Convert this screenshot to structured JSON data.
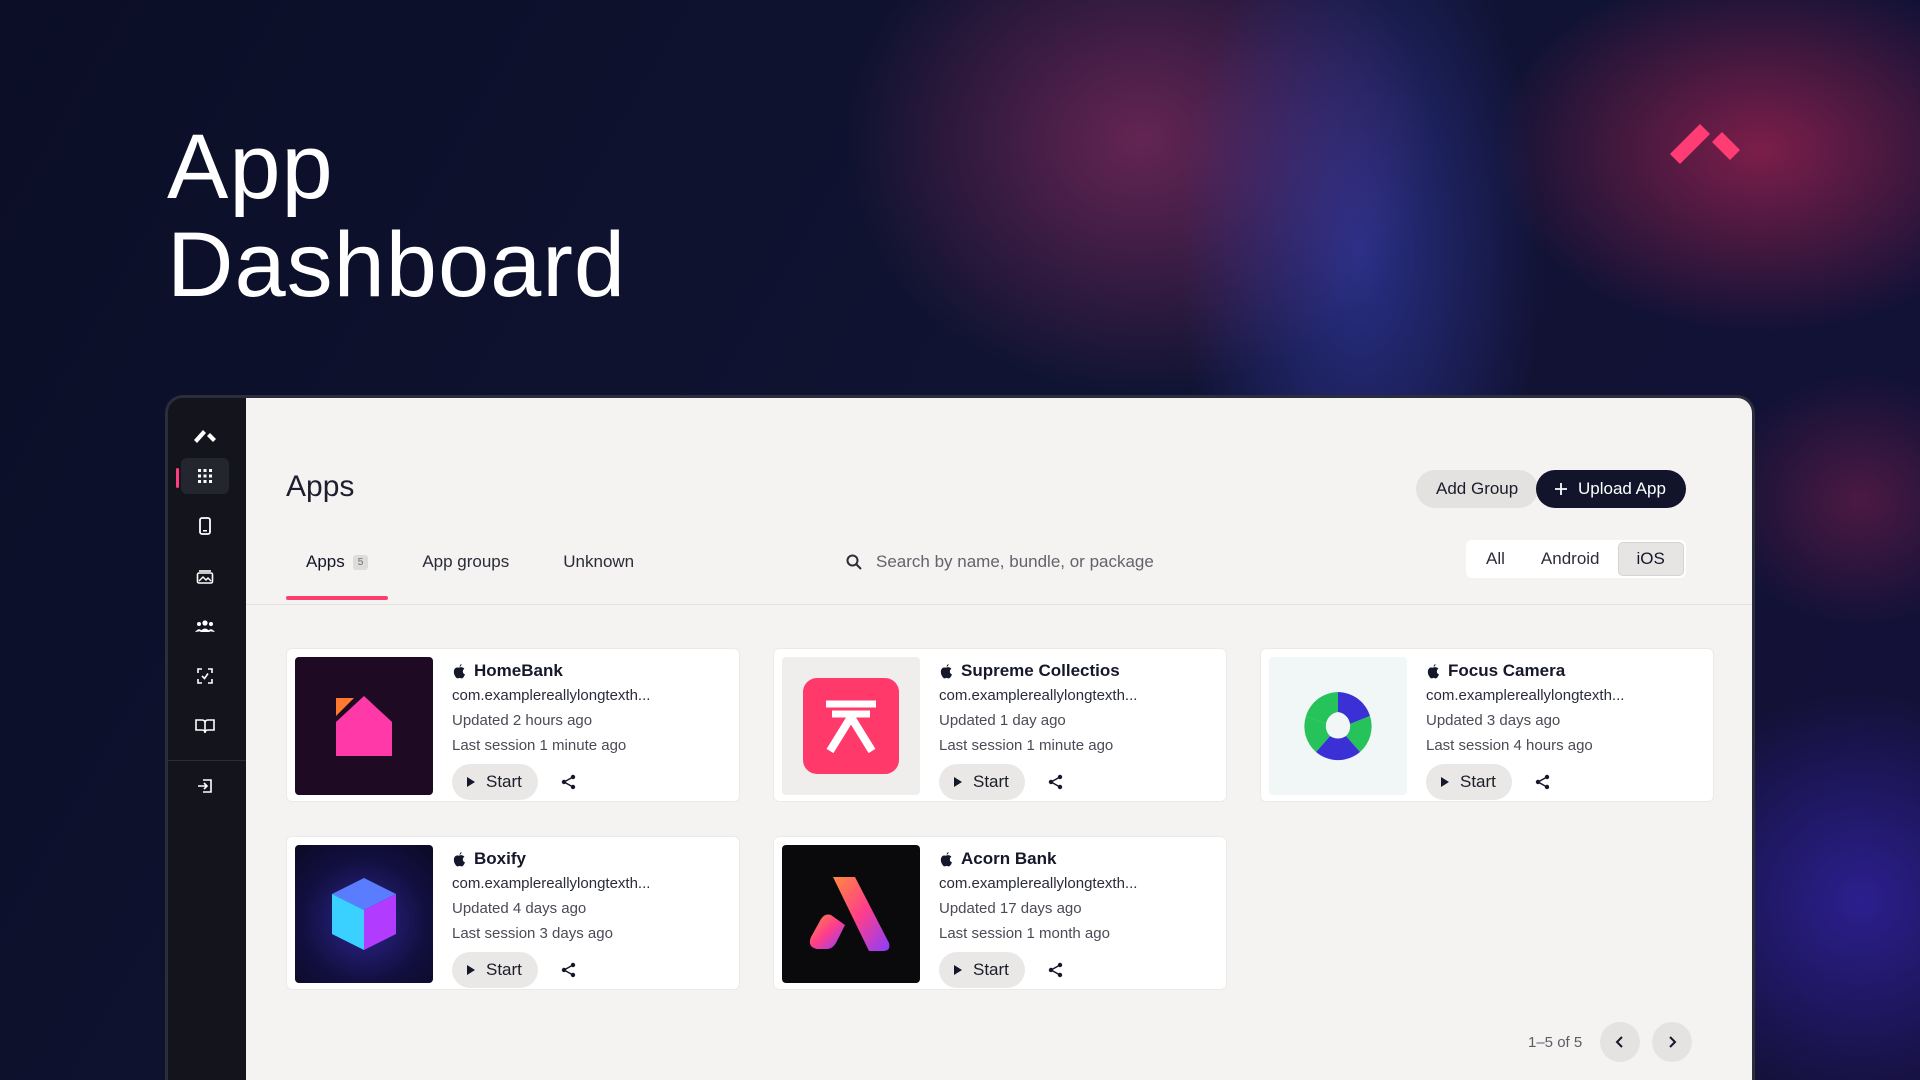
{
  "hero": {
    "title_line1": "App",
    "title_line2": "Dashboard"
  },
  "colors": {
    "accent": "#ff3d6e",
    "dark": "#11142b"
  },
  "sidebar": {
    "items": [
      {
        "icon": "logo-icon"
      },
      {
        "icon": "grid-icon",
        "active": true
      },
      {
        "icon": "phone-icon"
      },
      {
        "icon": "image-stack-icon"
      },
      {
        "icon": "users-icon"
      },
      {
        "icon": "scan-icon"
      },
      {
        "icon": "book-icon"
      },
      {
        "icon": "logout-icon"
      }
    ]
  },
  "header": {
    "title": "Apps",
    "add_group_label": "Add Group",
    "upload_label": "Upload App"
  },
  "tabs": [
    {
      "label": "Apps",
      "badge": "5",
      "active": true
    },
    {
      "label": "App groups"
    },
    {
      "label": "Unknown"
    }
  ],
  "search": {
    "placeholder": "Search by name, bundle, or package"
  },
  "platform_filter": {
    "options": [
      "All",
      "Android",
      "iOS"
    ],
    "selected": "iOS"
  },
  "apps": [
    {
      "name": "HomeBank",
      "bundle": "com.examplereallylongtexth...",
      "updated": "Updated 2 hours ago",
      "last_session": "Last session 1 minute ago",
      "start_label": "Start",
      "platform_icon": "apple-icon"
    },
    {
      "name": "Supreme Collectios",
      "bundle": "com.examplereallylongtexth...",
      "updated": "Updated 1 day ago",
      "last_session": "Last session 1 minute ago",
      "start_label": "Start",
      "platform_icon": "apple-icon"
    },
    {
      "name": "Focus Camera",
      "bundle": "com.examplereallylongtexth...",
      "updated": "Updated 3 days ago",
      "last_session": "Last session 4 hours ago",
      "start_label": "Start",
      "platform_icon": "apple-icon"
    },
    {
      "name": "Boxify",
      "bundle": "com.examplereallylongtexth...",
      "updated": "Updated 4 days ago",
      "last_session": "Last session 3 days ago",
      "start_label": "Start",
      "platform_icon": "apple-icon"
    },
    {
      "name": "Acorn Bank",
      "bundle": "com.examplereallylongtexth...",
      "updated": "Updated 17 days ago",
      "last_session": "Last session 1 month ago",
      "start_label": "Start",
      "platform_icon": "apple-icon"
    }
  ],
  "pagination": {
    "range_label": "1–5 of 5"
  }
}
